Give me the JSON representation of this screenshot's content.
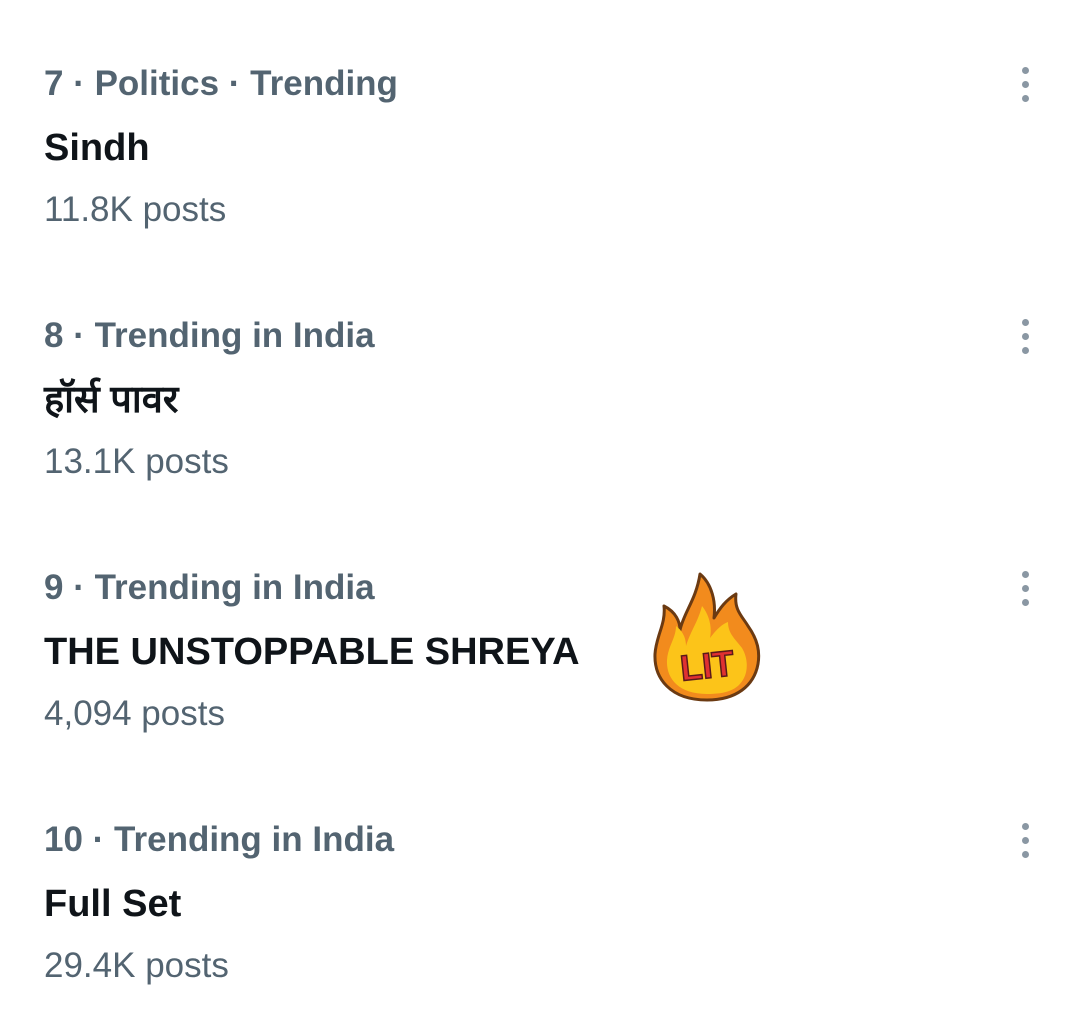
{
  "trends": [
    {
      "context": "7 · Politics · Trending",
      "title": "Sindh",
      "posts": "11.8K posts"
    },
    {
      "context": "8 · Trending in India",
      "title": "हॉर्स पावर",
      "posts": "13.1K posts"
    },
    {
      "context": "9 · Trending in India",
      "title": "THE UNSTOPPABLE SHREYA",
      "posts": "4,094 posts",
      "sticker": {
        "text": "LIT",
        "icon": "fire-icon"
      }
    },
    {
      "context": "10 · Trending in India",
      "title": "Full Set",
      "posts": "29.4K posts"
    }
  ],
  "colors": {
    "primary_text": "#0f1419",
    "secondary_text": "#536471",
    "more_dots": "#8a97a3",
    "flame_outer": "#f28b1d",
    "flame_inner": "#fcc419",
    "lit_text": "#e03131"
  }
}
